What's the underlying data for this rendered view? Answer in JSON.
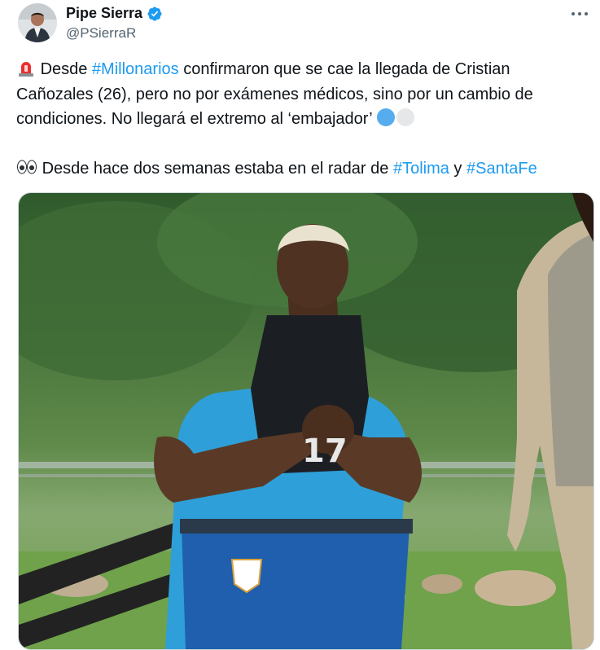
{
  "author": {
    "display_name": "Pipe Sierra",
    "handle": "@PSierraR",
    "verified_icon": "verified-badge-icon",
    "verified_color": "#1d9bf0"
  },
  "menu": {
    "more_icon": "more-horizontal-icon"
  },
  "tweet": {
    "line1_pre": "Desde ",
    "hashtag1": "#Millonarios",
    "line1_post": " confirmaron que se cae la llegada de Cristian Cañozales (26), pero no por exámenes médicos, sino por un cambio de condiciones. No llegará el extremo al ‘embajador’ ",
    "line2_pre": "Desde hace dos semanas estaba en el radar de ",
    "hashtag2": "#Tolima",
    "line2_mid": " y ",
    "hashtag3": "#SantaFe",
    "emojis": [
      "rotating-light-icon",
      "blue-circle-icon",
      "white-circle-icon",
      "eyes-icon"
    ]
  },
  "media": {
    "description_icon": "photo-icon",
    "colors": {
      "shirt": "#2e9fd8",
      "shorts": "#1f5fae",
      "vest": "#1b1f24",
      "grass": "#6ea04a",
      "trees": "#3d6b33"
    }
  }
}
